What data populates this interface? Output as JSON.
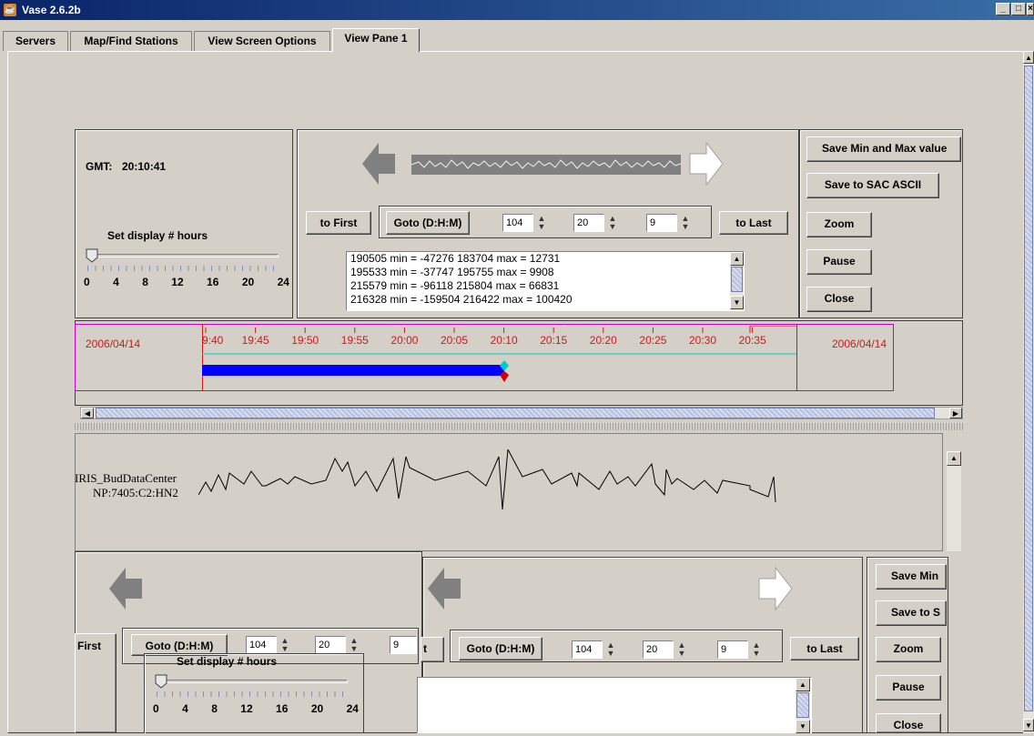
{
  "window": {
    "title": "Vase 2.6.2b",
    "controls": [
      "_",
      "□",
      "×"
    ]
  },
  "tabs": [
    "Servers",
    "Map/Find Stations",
    "View Screen Options",
    "View Pane 1"
  ],
  "pane1": {
    "gmt_label": "GMT:",
    "gmt_time": "20:10:41",
    "hours_label": "Set display # hours",
    "hour_ticks": [
      "0",
      "4",
      "8",
      "12",
      "16",
      "20",
      "24"
    ],
    "to_first": "to First",
    "goto_label": "Goto (D:H:M)",
    "goto_day": "104",
    "goto_hour": "20",
    "goto_min": "9",
    "to_last": "to Last",
    "log_lines": [
      "190505 min = -47276 183704 max = 12731",
      "195533 min = -37747 195755 max = 9908",
      "215579 min = -96118 215804 max = 66831",
      "216328 min = -159504 216422 max = 100420"
    ],
    "buttons": {
      "save_minmax": "Save Min and Max value",
      "save_sac": "Save to SAC ASCII",
      "zoom": "Zoom",
      "pause": "Pause",
      "close": "Close"
    }
  },
  "timeline": {
    "date_left": "2006/04/14",
    "date_right": "2006/04/14",
    "ticks": [
      "9:40",
      "19:45",
      "19:50",
      "19:55",
      "20:00",
      "20:05",
      "20:10",
      "20:15",
      "20:20",
      "20:25",
      "20:30",
      "20:35"
    ],
    "data_start": "9:40",
    "current_time": "20:10",
    "colors": {
      "tick": "#cc1a1a",
      "bar": "#0000ff",
      "frame": "#cc00cc",
      "cursor": "#00cccc"
    }
  },
  "station": {
    "name": "IRIS_BudDataCenter",
    "channel": "NP:7405:C2:HN2"
  },
  "pane2": {
    "first_label": "First",
    "goto_label_1": "Goto (D:H:M)",
    "goto_day_1": "104",
    "goto_hour_1": "20",
    "goto_min_1": "9",
    "hours_label": "Set display # hours",
    "hour_ticks": [
      "0",
      "4",
      "8",
      "12",
      "16",
      "20",
      "24"
    ],
    "t_label": "t",
    "goto_label_2": "Goto (D:H:M)",
    "goto_day_2": "104",
    "goto_hour_2": "20",
    "goto_min_2": "9",
    "to_last": "to Last",
    "buttons": {
      "save_min": "Save Min",
      "save_to_s": "Save to S",
      "zoom": "Zoom",
      "pause": "Pause",
      "close": "Close"
    }
  }
}
